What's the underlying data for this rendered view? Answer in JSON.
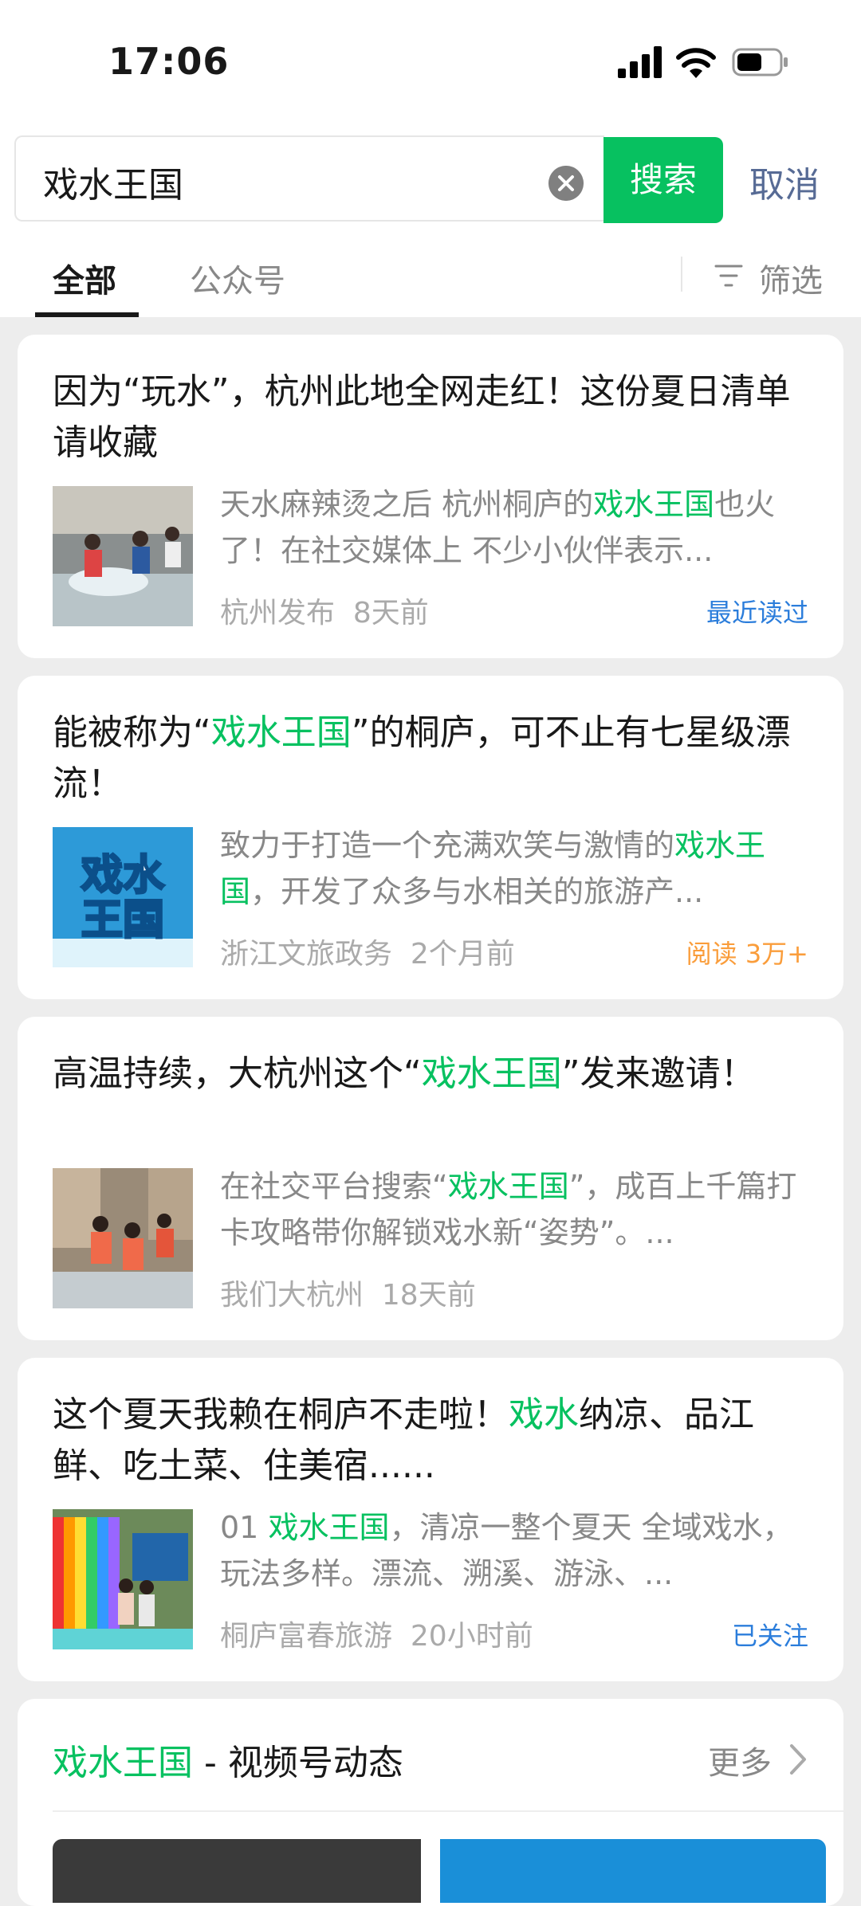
{
  "status_bar": {
    "time": "17:06"
  },
  "search": {
    "value": "戏水王国",
    "button": "搜索",
    "cancel": "取消"
  },
  "tabs": {
    "all": "全部",
    "public": "公众号",
    "filter": "筛选"
  },
  "articles": [
    {
      "title_parts": [
        "因为“玩水”，杭州此地全网走红！这份夏日清单请收藏"
      ],
      "desc_parts": [
        "天水麻辣烫之后 杭州桐庐的",
        "戏水王国",
        "也火了！在社交媒体上 不少小伙伴表示..."
      ],
      "source": "杭州发布",
      "time": "8天前",
      "badge": "最近读过",
      "badge_color": "#2b7ddb"
    },
    {
      "title_parts": [
        "能被称为“",
        "戏水王国",
        "”的桐庐，可不止有七星级漂流！"
      ],
      "desc_parts": [
        "致力于打造一个充满欢笑与激情的",
        "戏水王国",
        "，开发了众多与水相关的旅游产..."
      ],
      "source": "浙江文旅政务",
      "time": "2个月前",
      "badge": "阅读 3万+",
      "badge_color": "#fa9d3b",
      "thumb_text": [
        "戏水",
        "王国"
      ]
    },
    {
      "title_parts": [
        "高温持续，大杭州这个“",
        "戏水王国",
        "”发来邀请！"
      ],
      "desc_parts": [
        "在社交平台搜索“",
        "戏水王国",
        "”，成百上千篇打卡攻略带你解锁戏水新“姿势”。..."
      ],
      "source": "我们大杭州",
      "time": "18天前",
      "badge": "",
      "badge_color": "#2b7ddb"
    },
    {
      "title_parts": [
        "这个夏天我赖在桐庐不走啦！",
        "戏水",
        "纳凉、品江鲜、吃土菜、住美宿......"
      ],
      "desc_parts": [
        "01 ",
        "戏水王国",
        "，清凉一整个夏天 全域戏水，玩法多样。漂流、溯溪、游泳、..."
      ],
      "source": "桐庐富春旅游",
      "time": "20小时前",
      "badge": "已关注",
      "badge_color": "#2b7ddb"
    }
  ],
  "video_section": {
    "highlight": "戏水王国",
    "rest": " - 视频号动态",
    "more": "更多"
  },
  "colors": {
    "accent": "#07c160",
    "link": "#576b95"
  }
}
